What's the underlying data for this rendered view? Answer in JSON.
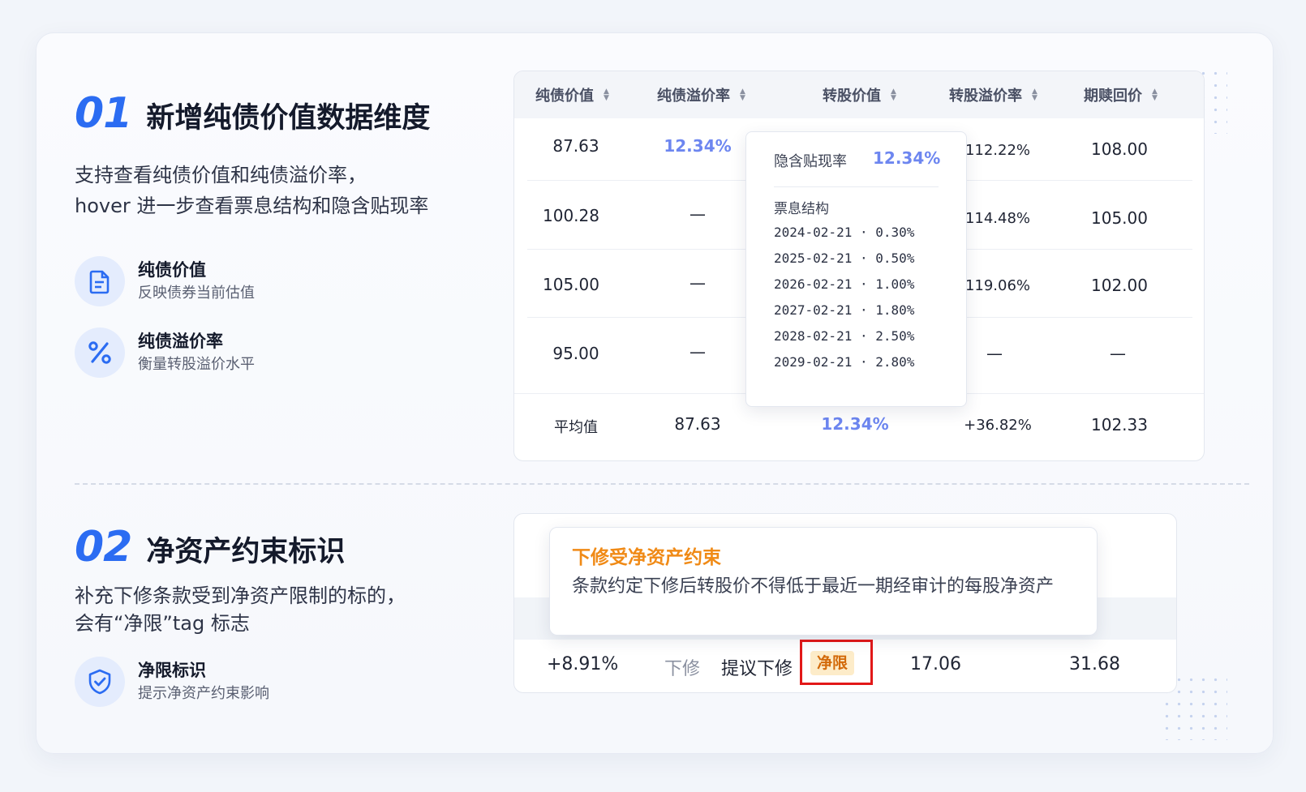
{
  "section1": {
    "num": "01",
    "title": "新增纯债价值数据维度",
    "desc_line1": "支持查看纯债价值和纯债溢价率，",
    "desc_line2": "hover 进一步查看票息结构和隐含贴现率",
    "features": [
      {
        "icon": "document-icon",
        "title": "纯债价值",
        "sub": "反映债券当前估值"
      },
      {
        "icon": "percent-icon",
        "title": "纯债溢价率",
        "sub": "衡量转股溢价水平"
      }
    ]
  },
  "table": {
    "headers": [
      "纯债价值",
      "纯债溢价率",
      "转股价值",
      "转股溢价率",
      "期赎回价"
    ],
    "rows": [
      [
        "87.63",
        "12.34%",
        "",
        "112.22%",
        "108.00"
      ],
      [
        "100.28",
        "—",
        "",
        "114.48%",
        "105.00"
      ],
      [
        "105.00",
        "—",
        "",
        "119.06%",
        "102.00"
      ],
      [
        "95.00",
        "—",
        "",
        "—",
        "—"
      ]
    ],
    "footer": [
      "平均值",
      "87.63",
      "12.34%",
      "+36.82%",
      "102.33"
    ]
  },
  "tooltip1": {
    "label": "隐含贴现率",
    "value": "12.34%",
    "sub_title": "票息结构",
    "coupons": [
      "2024-02-21 · 0.30%",
      "2025-02-21 · 0.50%",
      "2026-02-21 · 1.00%",
      "2027-02-21 · 1.80%",
      "2028-02-21 · 2.50%",
      "2029-02-21 · 2.80%"
    ]
  },
  "section2": {
    "num": "02",
    "title": "净资产约束标识",
    "desc_line1": "补充下修条款受到净资产限制的标的，",
    "desc_line2": "会有“净限”tag 标志",
    "features": [
      {
        "icon": "shield-check-icon",
        "title": "净限标识",
        "sub": "提示净资产约束影响"
      }
    ]
  },
  "row2": {
    "change": "+8.91%",
    "type": "下修",
    "status": "提议下修",
    "tag": "净限",
    "price1": "17.06",
    "price2": "31.68"
  },
  "tooltip2": {
    "title": "下修受净资产约束",
    "body": "条款约定下修后转股价不得低于最近一期经审计的每股净资产"
  },
  "colors": {
    "accent": "#2b6cf2",
    "highlight_blue": "#6d86f0",
    "warn_orange": "#f08a16",
    "tag_bg": "#fdecc9",
    "marker_red": "#e21818"
  }
}
